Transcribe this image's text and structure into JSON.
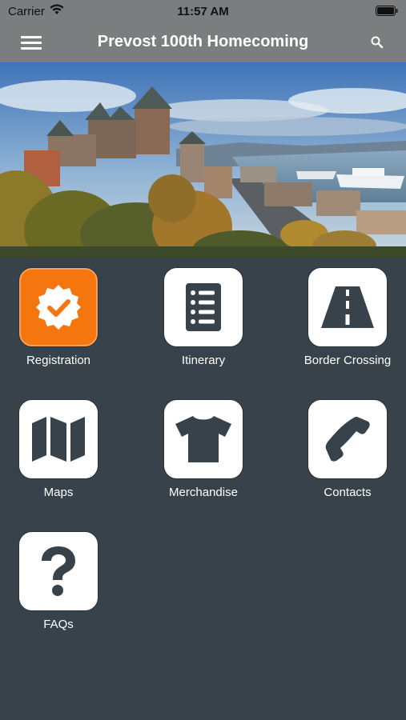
{
  "status_bar": {
    "carrier": "Carrier",
    "time": "11:57 AM"
  },
  "nav": {
    "title": "Prevost 100th Homecoming"
  },
  "tiles": [
    {
      "label": "Registration",
      "icon": "badge-check-icon"
    },
    {
      "label": "Itinerary",
      "icon": "list-icon"
    },
    {
      "label": "Border Crossing",
      "icon": "road-icon"
    },
    {
      "label": "Maps",
      "icon": "map-icon"
    },
    {
      "label": "Merchandise",
      "icon": "tshirt-icon"
    },
    {
      "label": "Contacts",
      "icon": "phone-icon"
    },
    {
      "label": "FAQs",
      "icon": "question-icon"
    }
  ],
  "colors": {
    "nav": "#7b7d7e",
    "background": "#37424a",
    "accent": "#f5750f",
    "icon": "#37424a"
  }
}
